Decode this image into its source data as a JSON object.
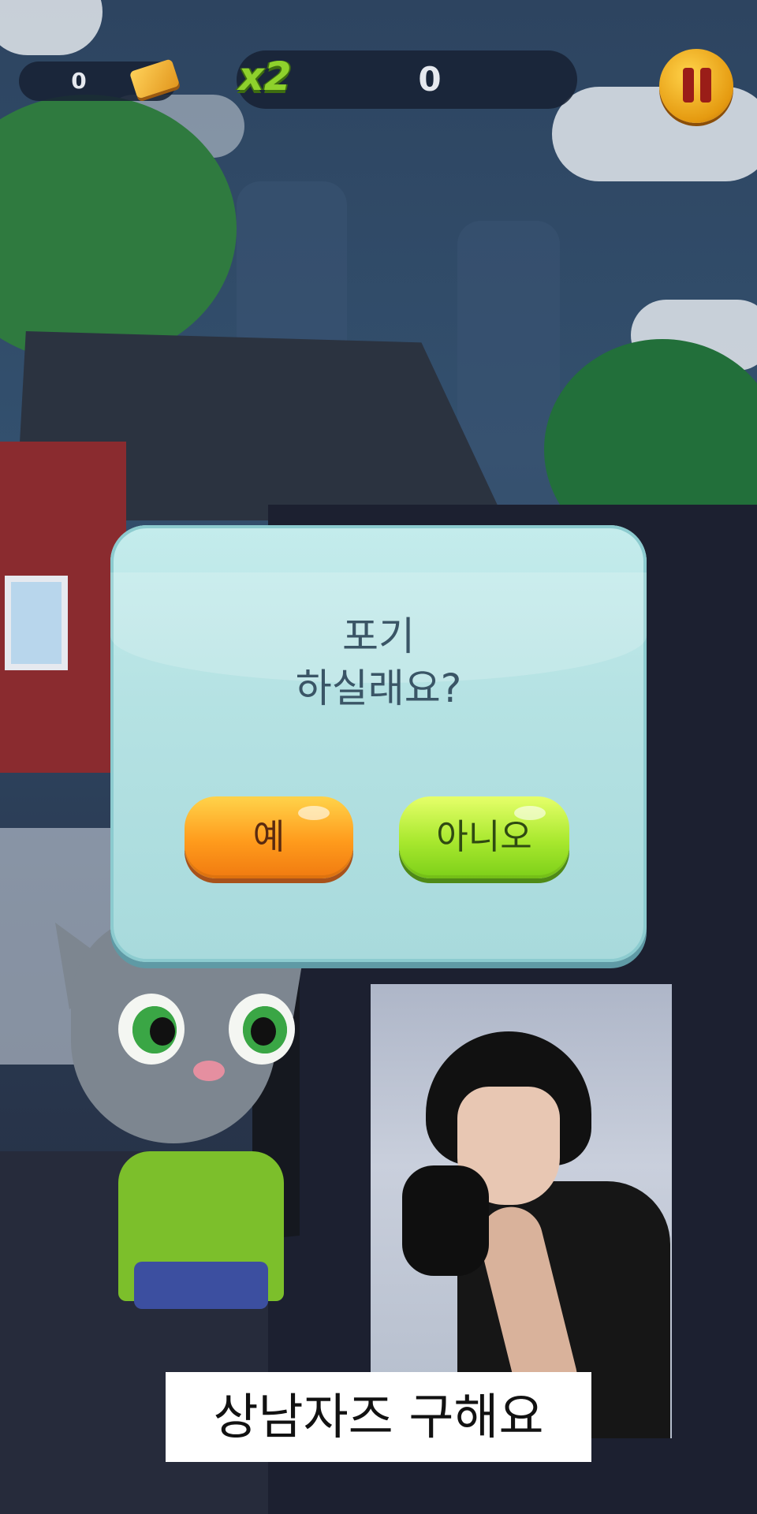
{
  "hud": {
    "coins": "0",
    "multiplier": "x2",
    "score": "0"
  },
  "dialog": {
    "title_line1": "포기",
    "title_line2": "하실래요?",
    "yes_label": "예",
    "no_label": "아니오"
  },
  "caption": {
    "text": "상남자즈 구해요"
  },
  "colors": {
    "dialog_bg": "#b5e2e3",
    "yes_button": "#ff9b1c",
    "no_button": "#a8e82e",
    "pause_button": "#f0a81a",
    "multiplier": "#8ed12c"
  },
  "icons": [
    "goldbar-icon",
    "pause-icon"
  ]
}
